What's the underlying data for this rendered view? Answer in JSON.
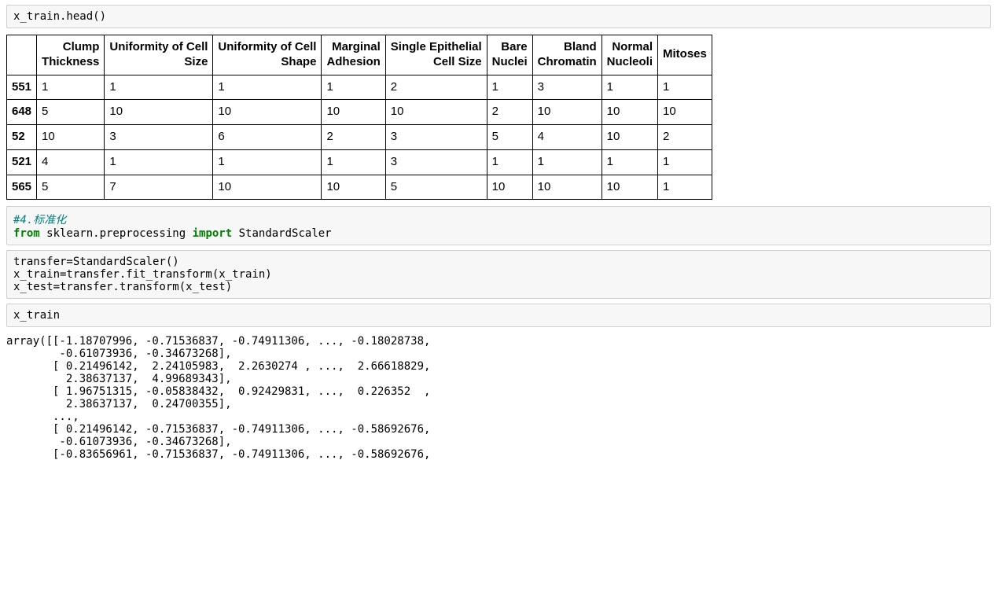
{
  "cells": {
    "code1": "x_train.head()",
    "code2_comment": "#4.标准化",
    "code2_from": "from",
    "code2_mod": " sklearn.preprocessing ",
    "code2_import": "import",
    "code2_name": " StandardScaler",
    "code3_line1": "transfer=StandardScaler()",
    "code3_line2": "x_train=transfer.fit_transform(x_train)",
    "code3_line3": "x_test=transfer.transform(x_test)",
    "code4": "x_train"
  },
  "table": {
    "columns": [
      "Clump Thickness",
      "Uniformity of Cell Size",
      "Uniformity of Cell Shape",
      "Marginal Adhesion",
      "Single Epithelial Cell Size",
      "Bare Nuclei",
      "Bland Chromatin",
      "Normal Nucleoli",
      "Mitoses"
    ],
    "col_br": {
      "0": "Clump\nThickness",
      "1": "Uniformity of Cell\nSize",
      "2": "Uniformity of Cell\nShape",
      "3": "Marginal\nAdhesion",
      "4": "Single Epithelial\nCell Size",
      "5": "Bare\nNuclei",
      "6": "Bland\nChromatin",
      "7": "Normal\nNucleoli",
      "8": "Mitoses"
    },
    "rows": [
      {
        "idx": "551",
        "vals": [
          "1",
          "1",
          "1",
          "1",
          "2",
          "1",
          "3",
          "1",
          "1"
        ]
      },
      {
        "idx": "648",
        "vals": [
          "5",
          "10",
          "10",
          "10",
          "10",
          "2",
          "10",
          "10",
          "10"
        ]
      },
      {
        "idx": "52",
        "vals": [
          "10",
          "3",
          "6",
          "2",
          "3",
          "5",
          "4",
          "10",
          "2"
        ]
      },
      {
        "idx": "521",
        "vals": [
          "4",
          "1",
          "1",
          "1",
          "3",
          "1",
          "1",
          "1",
          "1"
        ]
      },
      {
        "idx": "565",
        "vals": [
          "5",
          "7",
          "10",
          "10",
          "5",
          "10",
          "10",
          "10",
          "1"
        ]
      }
    ]
  },
  "array_output": "array([[-1.18707996, -0.71536837, -0.74911306, ..., -0.18028738,\n        -0.61073936, -0.34673268],\n       [ 0.21496142,  2.24105983,  2.2630274 , ...,  2.66618829,\n         2.38637137,  4.99689343],\n       [ 1.96751315, -0.05838432,  0.92429831, ...,  0.226352  ,\n         2.38637137,  0.24700355],\n       ...,\n       [ 0.21496142, -0.71536837, -0.74911306, ..., -0.58692676,\n        -0.61073936, -0.34673268],\n       [-0.83656961, -0.71536837, -0.74911306, ..., -0.58692676,"
}
